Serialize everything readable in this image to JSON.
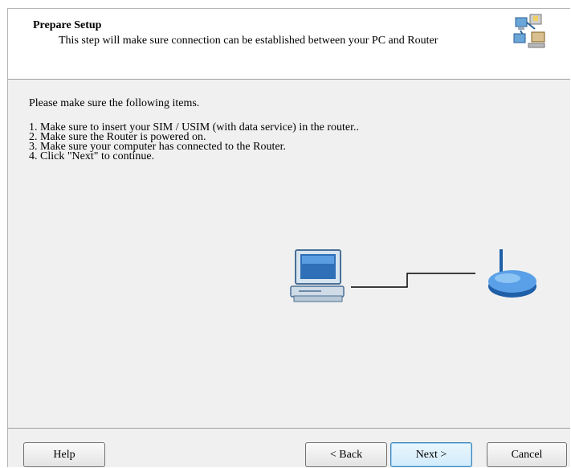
{
  "header": {
    "title": "Prepare Setup",
    "subtitle": "This step will make sure connection can be established between your PC and Router",
    "icon": "network-computers-icon"
  },
  "main": {
    "intro": "Please make sure the following items.",
    "items": [
      "1. Make sure to insert your SIM / USIM (with data service) in the router..",
      "2. Make sure the Router is powered on.",
      "3. Make sure your computer has connected to the Router.",
      "4. Click \"Next\" to continue."
    ],
    "illustration": {
      "left": "computer-icon",
      "right": "router-icon"
    }
  },
  "buttons": {
    "help": "Help",
    "back": "< Back",
    "next": "Next >",
    "cancel": "Cancel"
  }
}
